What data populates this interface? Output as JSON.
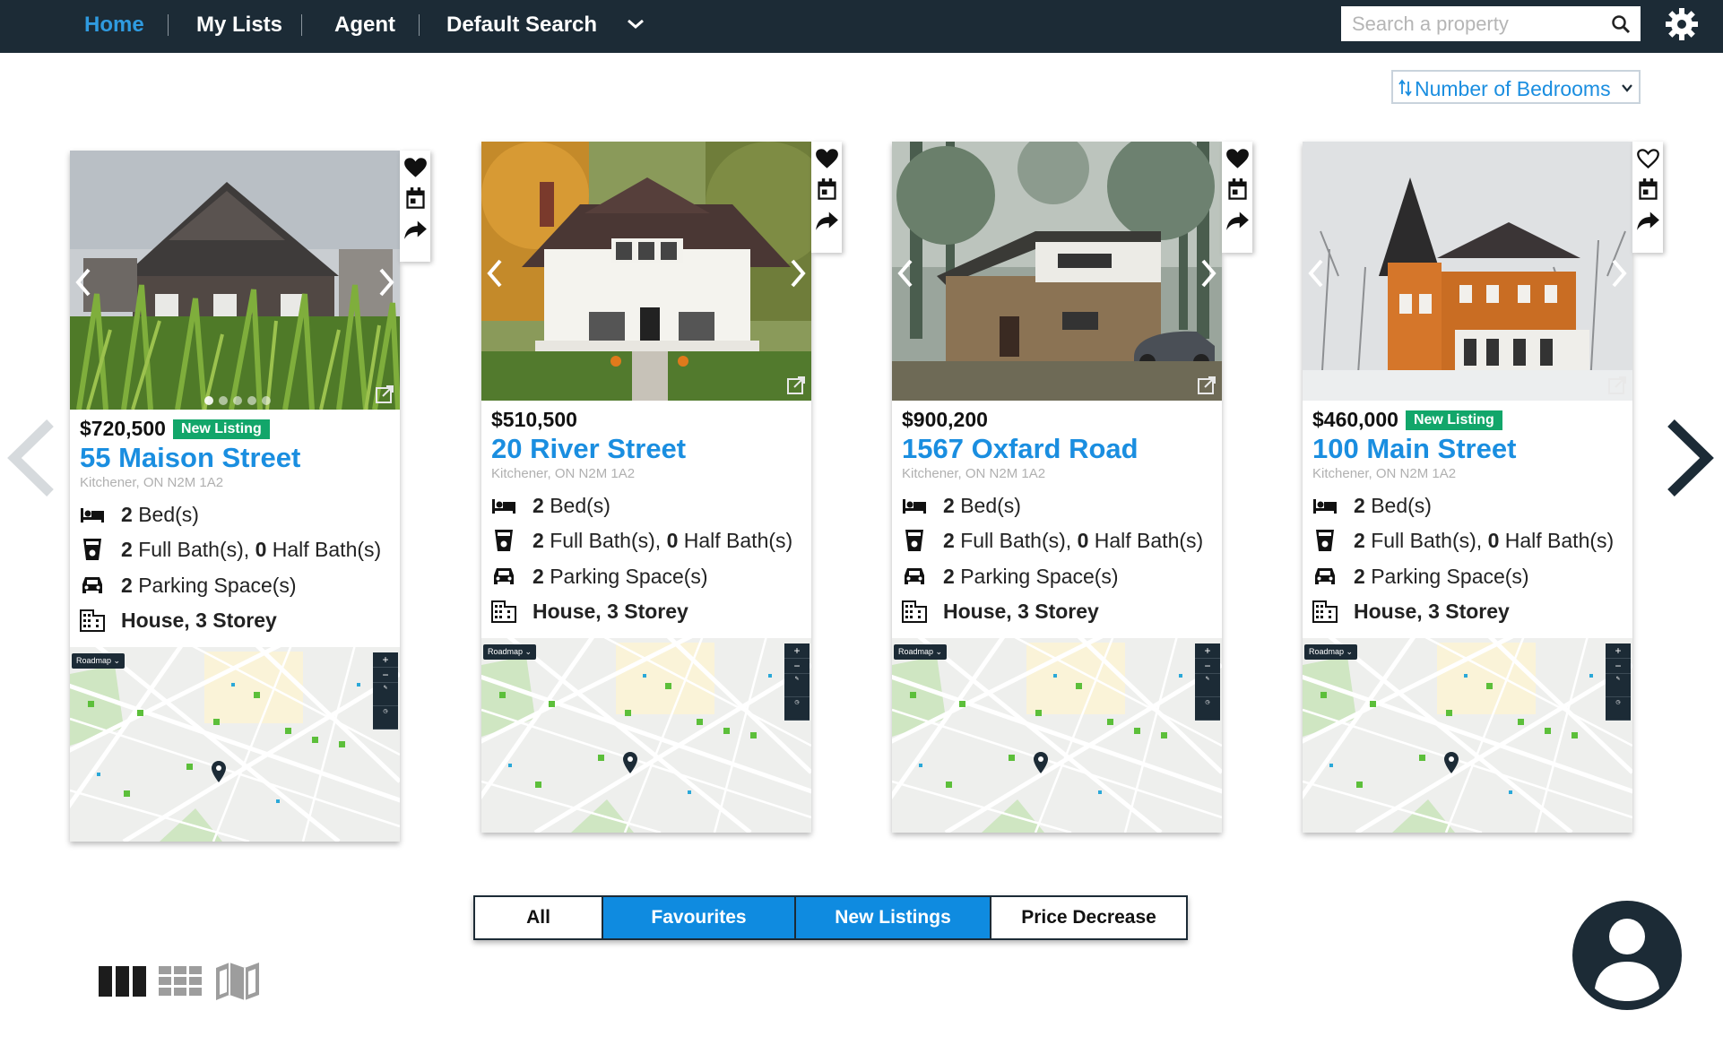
{
  "nav": {
    "links": [
      {
        "label": "Home",
        "active": true
      },
      {
        "label": "My Lists",
        "active": false
      },
      {
        "label": "Agent",
        "active": false
      },
      {
        "label": "Default Search",
        "active": false
      }
    ],
    "search": {
      "placeholder": "Search a property",
      "value": ""
    }
  },
  "sort": {
    "label": "Number of Bedrooms"
  },
  "listings": [
    {
      "price": "$720,500",
      "badge": "New Listing",
      "address": "55 Maison Street",
      "location": "Kitchener, ON N2M 1A2",
      "beds": "2",
      "beds_label": "Bed(s)",
      "full_baths": "2",
      "full_baths_label": "Full Bath(s),",
      "half_baths": "0",
      "half_baths_label": "Half Bath(s)",
      "parking": "2",
      "parking_label": "Parking Space(s)",
      "type": "House, 3 Storey",
      "favourite": true,
      "map_chip": "Roadmap"
    },
    {
      "price": "$510,500",
      "badge": "",
      "address": "20 River Street",
      "location": "Kitchener, ON N2M 1A2",
      "beds": "2",
      "beds_label": "Bed(s)",
      "full_baths": "2",
      "full_baths_label": "Full Bath(s),",
      "half_baths": "0",
      "half_baths_label": "Half Bath(s)",
      "parking": "2",
      "parking_label": "Parking Space(s)",
      "type": "House, 3 Storey",
      "favourite": true,
      "map_chip": "Roadmap"
    },
    {
      "price": "$900,200",
      "badge": "",
      "address": "1567 Oxfard Road",
      "location": "Kitchener, ON N2M 1A2",
      "beds": "2",
      "beds_label": "Bed(s)",
      "full_baths": "2",
      "full_baths_label": "Full Bath(s),",
      "half_baths": "0",
      "half_baths_label": "Half Bath(s)",
      "parking": "2",
      "parking_label": "Parking Space(s)",
      "type": "House, 3 Storey",
      "favourite": true,
      "map_chip": "Roadmap"
    },
    {
      "price": "$460,000",
      "badge": "New Listing",
      "address": "100 Main Street",
      "location": "Kitchener, ON N2M 1A2",
      "beds": "2",
      "beds_label": "Bed(s)",
      "full_baths": "2",
      "full_baths_label": "Full Bath(s),",
      "half_baths": "0",
      "half_baths_label": "Half Bath(s)",
      "parking": "2",
      "parking_label": "Parking Space(s)",
      "type": "House, 3 Storey",
      "favourite": false,
      "map_chip": "Roadmap"
    }
  ],
  "filters": [
    {
      "label": "All",
      "selected": false
    },
    {
      "label": "Favourites",
      "selected": true
    },
    {
      "label": "New Listings",
      "selected": true
    },
    {
      "label": "Price Decrease",
      "selected": false
    }
  ],
  "view_modes": [
    "columns-view-icon",
    "grid-view-icon",
    "map-view-icon"
  ],
  "colors": {
    "nav_bg": "#1c2b36",
    "accent_blue": "#1a8ee0",
    "badge_green": "#12a66a",
    "nav_active": "#2f9be0"
  }
}
